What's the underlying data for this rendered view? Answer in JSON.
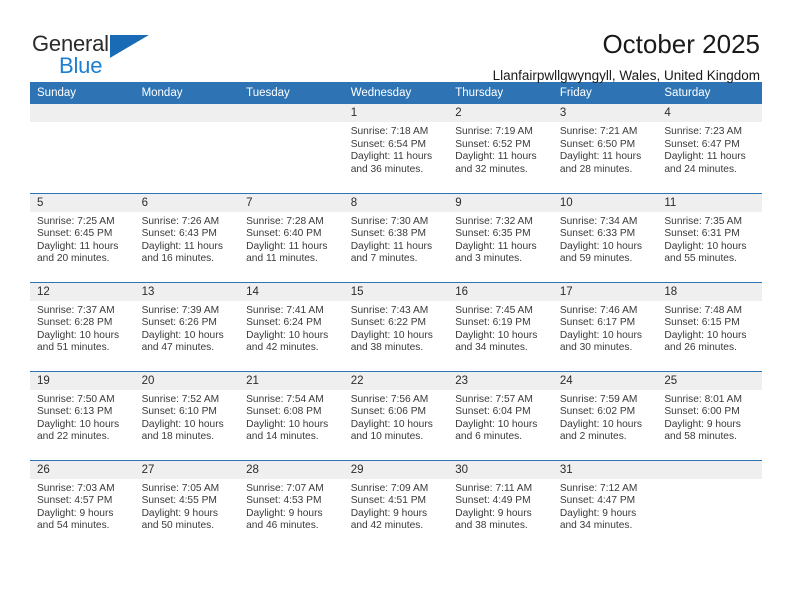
{
  "logo": {
    "text_primary": "General",
    "text_secondary": "Blue",
    "triangle_color": "#1a6bb5",
    "blue_color": "#1b7fd4"
  },
  "header": {
    "title": "October 2025",
    "subtitle": "Llanfairpwllgwyngyll, Wales, United Kingdom",
    "accent_color": "#2e74b5"
  },
  "calendar": {
    "weekday_headers": [
      "Sunday",
      "Monday",
      "Tuesday",
      "Wednesday",
      "Thursday",
      "Friday",
      "Saturday"
    ],
    "weeks": [
      [
        {
          "day": "",
          "empty": true
        },
        {
          "day": "",
          "empty": true
        },
        {
          "day": "",
          "empty": true
        },
        {
          "day": "1",
          "sunrise": "Sunrise: 7:18 AM",
          "sunset": "Sunset: 6:54 PM",
          "daylight_line1": "Daylight: 11 hours",
          "daylight_line2": "and 36 minutes."
        },
        {
          "day": "2",
          "sunrise": "Sunrise: 7:19 AM",
          "sunset": "Sunset: 6:52 PM",
          "daylight_line1": "Daylight: 11 hours",
          "daylight_line2": "and 32 minutes."
        },
        {
          "day": "3",
          "sunrise": "Sunrise: 7:21 AM",
          "sunset": "Sunset: 6:50 PM",
          "daylight_line1": "Daylight: 11 hours",
          "daylight_line2": "and 28 minutes."
        },
        {
          "day": "4",
          "sunrise": "Sunrise: 7:23 AM",
          "sunset": "Sunset: 6:47 PM",
          "daylight_line1": "Daylight: 11 hours",
          "daylight_line2": "and 24 minutes."
        }
      ],
      [
        {
          "day": "5",
          "sunrise": "Sunrise: 7:25 AM",
          "sunset": "Sunset: 6:45 PM",
          "daylight_line1": "Daylight: 11 hours",
          "daylight_line2": "and 20 minutes."
        },
        {
          "day": "6",
          "sunrise": "Sunrise: 7:26 AM",
          "sunset": "Sunset: 6:43 PM",
          "daylight_line1": "Daylight: 11 hours",
          "daylight_line2": "and 16 minutes."
        },
        {
          "day": "7",
          "sunrise": "Sunrise: 7:28 AM",
          "sunset": "Sunset: 6:40 PM",
          "daylight_line1": "Daylight: 11 hours",
          "daylight_line2": "and 11 minutes."
        },
        {
          "day": "8",
          "sunrise": "Sunrise: 7:30 AM",
          "sunset": "Sunset: 6:38 PM",
          "daylight_line1": "Daylight: 11 hours",
          "daylight_line2": "and 7 minutes."
        },
        {
          "day": "9",
          "sunrise": "Sunrise: 7:32 AM",
          "sunset": "Sunset: 6:35 PM",
          "daylight_line1": "Daylight: 11 hours",
          "daylight_line2": "and 3 minutes."
        },
        {
          "day": "10",
          "sunrise": "Sunrise: 7:34 AM",
          "sunset": "Sunset: 6:33 PM",
          "daylight_line1": "Daylight: 10 hours",
          "daylight_line2": "and 59 minutes."
        },
        {
          "day": "11",
          "sunrise": "Sunrise: 7:35 AM",
          "sunset": "Sunset: 6:31 PM",
          "daylight_line1": "Daylight: 10 hours",
          "daylight_line2": "and 55 minutes."
        }
      ],
      [
        {
          "day": "12",
          "sunrise": "Sunrise: 7:37 AM",
          "sunset": "Sunset: 6:28 PM",
          "daylight_line1": "Daylight: 10 hours",
          "daylight_line2": "and 51 minutes."
        },
        {
          "day": "13",
          "sunrise": "Sunrise: 7:39 AM",
          "sunset": "Sunset: 6:26 PM",
          "daylight_line1": "Daylight: 10 hours",
          "daylight_line2": "and 47 minutes."
        },
        {
          "day": "14",
          "sunrise": "Sunrise: 7:41 AM",
          "sunset": "Sunset: 6:24 PM",
          "daylight_line1": "Daylight: 10 hours",
          "daylight_line2": "and 42 minutes."
        },
        {
          "day": "15",
          "sunrise": "Sunrise: 7:43 AM",
          "sunset": "Sunset: 6:22 PM",
          "daylight_line1": "Daylight: 10 hours",
          "daylight_line2": "and 38 minutes."
        },
        {
          "day": "16",
          "sunrise": "Sunrise: 7:45 AM",
          "sunset": "Sunset: 6:19 PM",
          "daylight_line1": "Daylight: 10 hours",
          "daylight_line2": "and 34 minutes."
        },
        {
          "day": "17",
          "sunrise": "Sunrise: 7:46 AM",
          "sunset": "Sunset: 6:17 PM",
          "daylight_line1": "Daylight: 10 hours",
          "daylight_line2": "and 30 minutes."
        },
        {
          "day": "18",
          "sunrise": "Sunrise: 7:48 AM",
          "sunset": "Sunset: 6:15 PM",
          "daylight_line1": "Daylight: 10 hours",
          "daylight_line2": "and 26 minutes."
        }
      ],
      [
        {
          "day": "19",
          "sunrise": "Sunrise: 7:50 AM",
          "sunset": "Sunset: 6:13 PM",
          "daylight_line1": "Daylight: 10 hours",
          "daylight_line2": "and 22 minutes."
        },
        {
          "day": "20",
          "sunrise": "Sunrise: 7:52 AM",
          "sunset": "Sunset: 6:10 PM",
          "daylight_line1": "Daylight: 10 hours",
          "daylight_line2": "and 18 minutes."
        },
        {
          "day": "21",
          "sunrise": "Sunrise: 7:54 AM",
          "sunset": "Sunset: 6:08 PM",
          "daylight_line1": "Daylight: 10 hours",
          "daylight_line2": "and 14 minutes."
        },
        {
          "day": "22",
          "sunrise": "Sunrise: 7:56 AM",
          "sunset": "Sunset: 6:06 PM",
          "daylight_line1": "Daylight: 10 hours",
          "daylight_line2": "and 10 minutes."
        },
        {
          "day": "23",
          "sunrise": "Sunrise: 7:57 AM",
          "sunset": "Sunset: 6:04 PM",
          "daylight_line1": "Daylight: 10 hours",
          "daylight_line2": "and 6 minutes."
        },
        {
          "day": "24",
          "sunrise": "Sunrise: 7:59 AM",
          "sunset": "Sunset: 6:02 PM",
          "daylight_line1": "Daylight: 10 hours",
          "daylight_line2": "and 2 minutes."
        },
        {
          "day": "25",
          "sunrise": "Sunrise: 8:01 AM",
          "sunset": "Sunset: 6:00 PM",
          "daylight_line1": "Daylight: 9 hours",
          "daylight_line2": "and 58 minutes."
        }
      ],
      [
        {
          "day": "26",
          "sunrise": "Sunrise: 7:03 AM",
          "sunset": "Sunset: 4:57 PM",
          "daylight_line1": "Daylight: 9 hours",
          "daylight_line2": "and 54 minutes."
        },
        {
          "day": "27",
          "sunrise": "Sunrise: 7:05 AM",
          "sunset": "Sunset: 4:55 PM",
          "daylight_line1": "Daylight: 9 hours",
          "daylight_line2": "and 50 minutes."
        },
        {
          "day": "28",
          "sunrise": "Sunrise: 7:07 AM",
          "sunset": "Sunset: 4:53 PM",
          "daylight_line1": "Daylight: 9 hours",
          "daylight_line2": "and 46 minutes."
        },
        {
          "day": "29",
          "sunrise": "Sunrise: 7:09 AM",
          "sunset": "Sunset: 4:51 PM",
          "daylight_line1": "Daylight: 9 hours",
          "daylight_line2": "and 42 minutes."
        },
        {
          "day": "30",
          "sunrise": "Sunrise: 7:11 AM",
          "sunset": "Sunset: 4:49 PM",
          "daylight_line1": "Daylight: 9 hours",
          "daylight_line2": "and 38 minutes."
        },
        {
          "day": "31",
          "sunrise": "Sunrise: 7:12 AM",
          "sunset": "Sunset: 4:47 PM",
          "daylight_line1": "Daylight: 9 hours",
          "daylight_line2": "and 34 minutes."
        },
        {
          "day": "",
          "empty": true
        }
      ]
    ]
  }
}
